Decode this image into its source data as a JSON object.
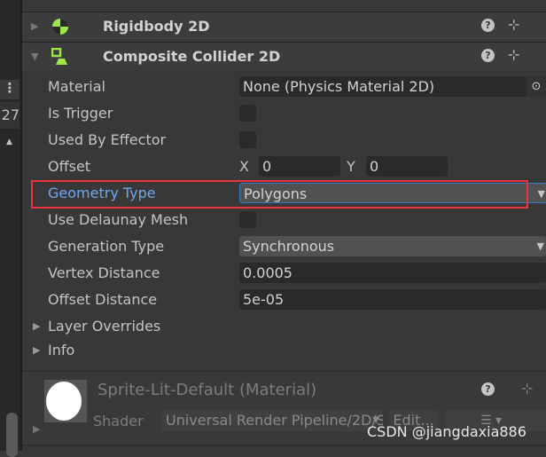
{
  "left_strip": {
    "menu_glyph": "⋮",
    "number": "27",
    "scroll_up": "▲"
  },
  "components": [
    {
      "title": "Rigidbody 2D",
      "expanded": false,
      "icon": "rigidbody-icon"
    },
    {
      "title": "Composite Collider 2D",
      "expanded": true,
      "icon": "composite-collider-icon"
    }
  ],
  "icons": {
    "help": "?",
    "preset": "⊹",
    "more": "⋮"
  },
  "fields": {
    "material": {
      "label": "Material",
      "value": "None (Physics Material 2D)"
    },
    "is_trigger": {
      "label": "Is Trigger",
      "checked": false
    },
    "used_by_effector": {
      "label": "Used By Effector",
      "checked": false
    },
    "offset": {
      "label": "Offset",
      "x_label": "X",
      "x": "0",
      "y_label": "Y",
      "y": "0"
    },
    "geometry_type": {
      "label": "Geometry Type",
      "value": "Polygons",
      "highlight_color": "#e8343a",
      "focus_color": "#3a79c4"
    },
    "use_delaunay_mesh": {
      "label": "Use Delaunay Mesh",
      "checked": false
    },
    "generation_type": {
      "label": "Generation Type",
      "value": "Synchronous"
    },
    "vertex_distance": {
      "label": "Vertex Distance",
      "value": "0.0005"
    },
    "offset_distance": {
      "label": "Offset Distance",
      "value": "5e-05"
    }
  },
  "foldouts": {
    "layer_overrides": "Layer Overrides",
    "info": "Info"
  },
  "material_section": {
    "name": "Sprite-Lit-Default (Material)",
    "shader_label": "Shader",
    "shader_value": "Universal Render Pipeline/2D/S",
    "edit_label": "Edit..."
  },
  "watermark": "CSDN @jiangdaxia886"
}
